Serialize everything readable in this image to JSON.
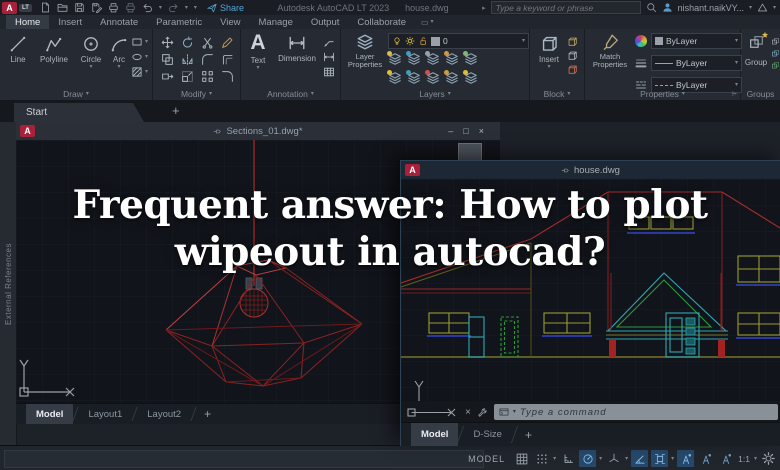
{
  "titlebar": {
    "logo_a": "A",
    "logo_lt": "LT",
    "share_label": "Share",
    "app_title": "Autodesk AutoCAD LT 2023",
    "doc_title": "house.dwg",
    "search_placeholder": "Type a keyword or phrase",
    "user_name": "nishant.naikVY..."
  },
  "ribbon": {
    "tabs": [
      "Home",
      "Insert",
      "Annotate",
      "Parametric",
      "View",
      "Manage",
      "Output",
      "Collaborate"
    ],
    "draw": {
      "label": "Draw",
      "tools": [
        "Line",
        "Polyline",
        "Circle",
        "Arc"
      ]
    },
    "modify": {
      "label": "Modify"
    },
    "annotation": {
      "label": "Annotation",
      "text_tool": "Text",
      "dimension_tool": "Dimension"
    },
    "layers": {
      "label": "Layers",
      "properties_button_line1": "Layer",
      "properties_button_line2": "Properties",
      "current_layer": "0"
    },
    "block": {
      "label": "Block",
      "insert_button": "Insert"
    },
    "properties": {
      "label": "Properties",
      "match_line1": "Match",
      "match_line2": "Properties",
      "color_value": "ByLayer",
      "lineweight_value": "ByLayer",
      "linetype_value": "ByLayer"
    },
    "groups": {
      "label": "Groups",
      "group_button": "Group"
    }
  },
  "file_tabs": {
    "start": "Start",
    "add": "+"
  },
  "panels_left": {
    "external_references": "External References"
  },
  "sections_window": {
    "title": "Sections_01.dwg*",
    "controls": {
      "minimize": "–",
      "maximize": "□",
      "close": "×"
    },
    "tabs": [
      "Model",
      "Layout1",
      "Layout2"
    ],
    "add_tab": "+"
  },
  "house_window": {
    "title": "house.dwg",
    "close_glyph": "×",
    "command_placeholder": "Type a command",
    "tabs": [
      "Model",
      "D-Size"
    ],
    "add_tab": "+"
  },
  "overlay": {
    "line1": "Frequent answer: How to plot",
    "line2": "wipeout in autocad?"
  },
  "statusbar": {
    "model_label": "MODEL",
    "scale_label": "1:1"
  },
  "colors": {
    "accent_red": "#a8203a",
    "wire_red": "#9b2727",
    "cyan": "#2fa8b4",
    "green": "#2f9a3a",
    "olive": "#9a9a35",
    "blue": "#3344cc",
    "status_active": "#26496b"
  }
}
